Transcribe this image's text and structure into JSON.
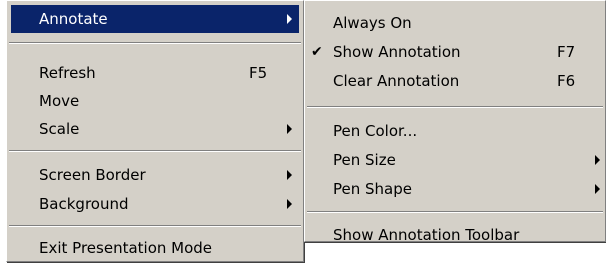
{
  "main_menu": {
    "items": [
      {
        "label": "Annotate",
        "shortcut": "",
        "has_submenu": true,
        "selected": true
      },
      {
        "label": "Refresh",
        "shortcut": "F5",
        "has_submenu": false
      },
      {
        "label": "Move",
        "shortcut": "",
        "has_submenu": false
      },
      {
        "label": "Scale",
        "shortcut": "",
        "has_submenu": true
      },
      {
        "label": "Screen Border",
        "shortcut": "",
        "has_submenu": true
      },
      {
        "label": "Background",
        "shortcut": "",
        "has_submenu": true
      },
      {
        "label": "Exit Presentation Mode",
        "shortcut": "",
        "has_submenu": false
      }
    ]
  },
  "annotate_submenu": {
    "items": [
      {
        "label": "Always On",
        "shortcut": "",
        "checked": false,
        "has_submenu": false
      },
      {
        "label": "Show Annotation",
        "shortcut": "F7",
        "checked": true,
        "has_submenu": false
      },
      {
        "label": "Clear Annotation",
        "shortcut": "F6",
        "checked": false,
        "has_submenu": false
      },
      {
        "label": "Pen Color...",
        "shortcut": "",
        "checked": false,
        "has_submenu": false
      },
      {
        "label": "Pen Size",
        "shortcut": "",
        "checked": false,
        "has_submenu": true
      },
      {
        "label": "Pen Shape",
        "shortcut": "",
        "checked": false,
        "has_submenu": true
      },
      {
        "label": "Show Annotation Toolbar",
        "shortcut": "",
        "checked": false,
        "has_submenu": false
      }
    ],
    "check_glyph": "✔"
  },
  "colors": {
    "menu_background": "#d4d0c8",
    "selection_highlight": "#0a246a",
    "selection_text": "#ffffff",
    "separator_dark": "#808080"
  }
}
